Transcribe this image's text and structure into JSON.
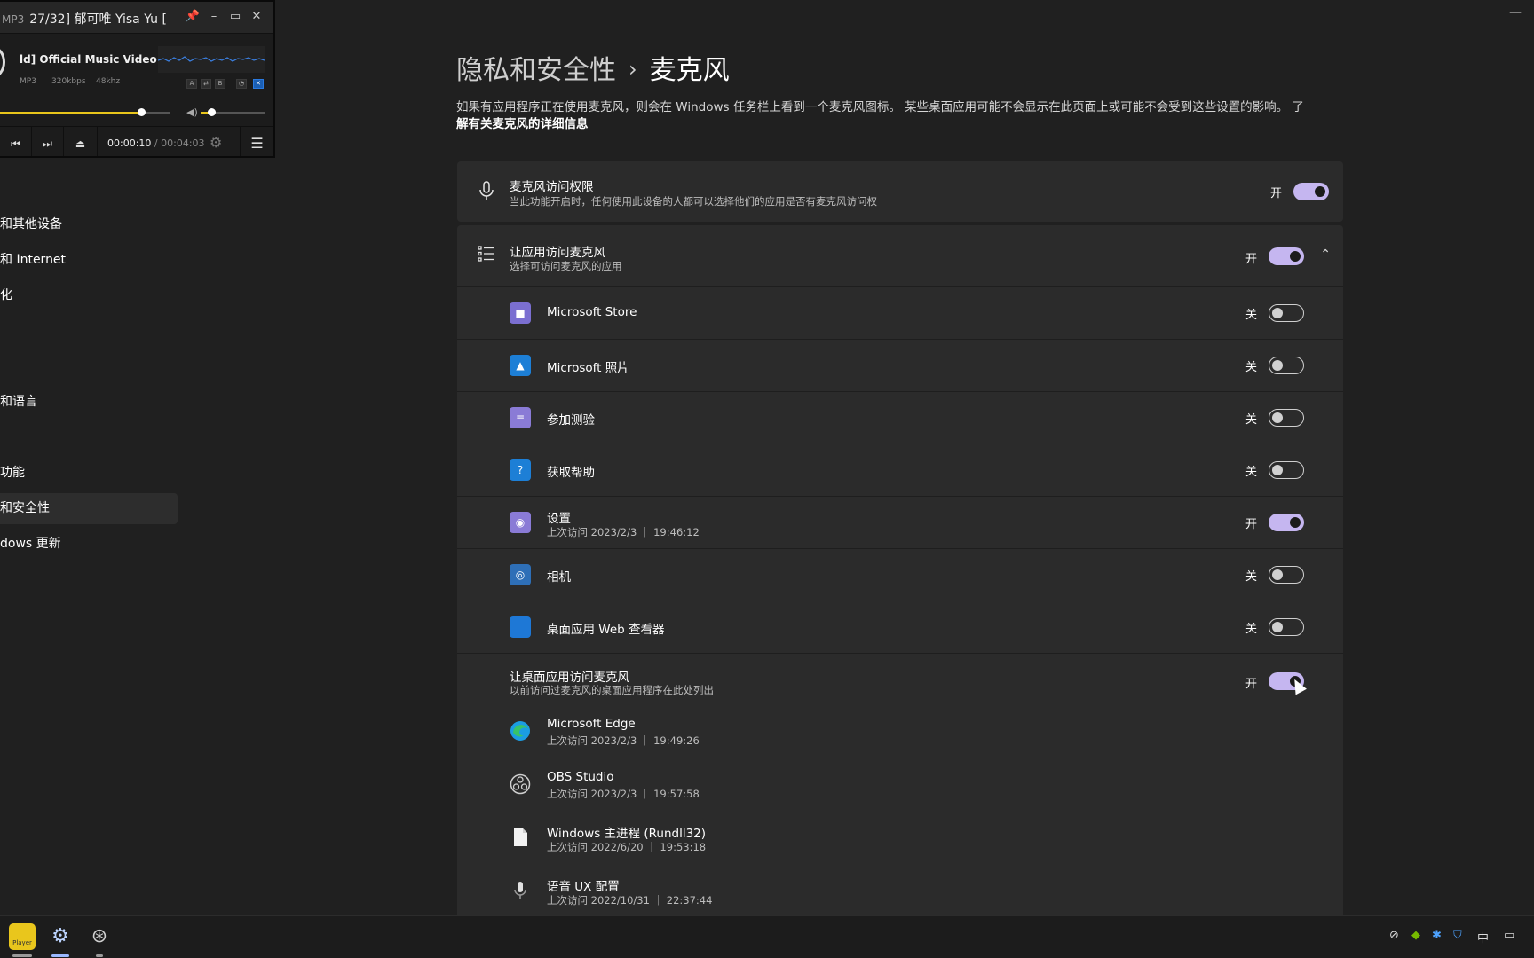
{
  "player": {
    "title_tag": "MP3",
    "title": "27/32] 郁可唯 Yisa Yu [",
    "window_buttons": [
      "📌",
      "–",
      "▭",
      "✕"
    ],
    "song": "ld] Official Music Video（",
    "format": "MP3",
    "bitrate": "320kbps",
    "samplerate": "48khz",
    "mini_buttons": [
      "A",
      "⇄",
      "B",
      "◔",
      "✕"
    ],
    "progress": 0.83,
    "volume": 0.17,
    "elapsed": "00:00:10",
    "separator": "/",
    "duration": "00:04:03"
  },
  "nav": {
    "items": [
      {
        "label": "和其他设备",
        "active": false
      },
      {
        "label": "和 Internet",
        "active": false
      },
      {
        "label": "化",
        "active": false
      },
      {
        "label": "和语言",
        "active": false
      },
      {
        "label": "功能",
        "active": false
      },
      {
        "label": "和安全性",
        "active": true
      },
      {
        "label": "dows 更新",
        "active": false
      }
    ]
  },
  "header": {
    "parent": "隐私和安全性",
    "separator": "›",
    "current": "麦克风",
    "description": "如果有应用程序正在使用麦克风，则会在 Windows 任务栏上看到一个麦克风图标。 某些桌面应用可能不会显示在此页面上或可能不会受到这些设置的影响。 了",
    "learn_more": "解有关麦克风的详细信息"
  },
  "mic_access": {
    "title": "麦克风访问权限",
    "subtitle": "当此功能开启时，任何使用此设备的人都可以选择他们的应用是否有麦克风访问权",
    "state": "开",
    "on": true
  },
  "app_access": {
    "title": "让应用访问麦克风",
    "subtitle": "选择可访问麦克风的应用",
    "state": "开",
    "on": true
  },
  "apps": [
    {
      "name": "Microsoft Store",
      "sub": "",
      "state": "关",
      "on": false,
      "icon": "store-icon",
      "color": "#7b6fd1",
      "glyph": "■"
    },
    {
      "name": "Microsoft 照片",
      "sub": "",
      "state": "关",
      "on": false,
      "icon": "photos-icon",
      "color": "#1d7fd6",
      "glyph": "▲"
    },
    {
      "name": "参加测验",
      "sub": "",
      "state": "关",
      "on": false,
      "icon": "quiz-icon",
      "color": "#8a7bd6",
      "glyph": "≡"
    },
    {
      "name": "获取帮助",
      "sub": "",
      "state": "关",
      "on": false,
      "icon": "help-icon",
      "color": "#1d7fd6",
      "glyph": "?"
    },
    {
      "name": "设置",
      "sub": "上次访问 2023/2/3 ｜ 19:46:12",
      "state": "开",
      "on": true,
      "icon": "settings-icon",
      "color": "#8a7bd6",
      "glyph": "◉"
    },
    {
      "name": "相机",
      "sub": "",
      "state": "关",
      "on": false,
      "icon": "camera-icon",
      "color": "#2e6fb7",
      "glyph": "◎"
    },
    {
      "name": "桌面应用 Web 查看器",
      "sub": "",
      "state": "关",
      "on": false,
      "icon": "web-viewer-icon",
      "color": "#1e78d6",
      "glyph": ""
    }
  ],
  "desktop_access": {
    "title": "让桌面应用访问麦克风",
    "subtitle": "以前访问过麦克风的桌面应用程序在此处列出",
    "state": "开",
    "on": true
  },
  "desktop_apps": [
    {
      "name": "Microsoft Edge",
      "sub": "上次访问 2023/2/3 ｜ 19:49:26",
      "icon": "edge-icon"
    },
    {
      "name": "OBS Studio",
      "sub": "上次访问 2023/2/3 ｜ 19:57:58",
      "icon": "obs-icon"
    },
    {
      "name": "Windows 主进程 (Rundll32)",
      "sub": "上次访问 2022/6/20 ｜ 19:53:18",
      "icon": "file-icon"
    },
    {
      "name": "语音 UX 配置",
      "sub": "上次访问 2022/10/31 ｜ 22:37:44",
      "icon": "microphone-icon"
    }
  ],
  "taskbar": {
    "player_label": "Player",
    "tray": [
      "⊘",
      "◆",
      "✱",
      "⛉",
      "中",
      "▭"
    ]
  },
  "window": {
    "minimize": "—"
  }
}
